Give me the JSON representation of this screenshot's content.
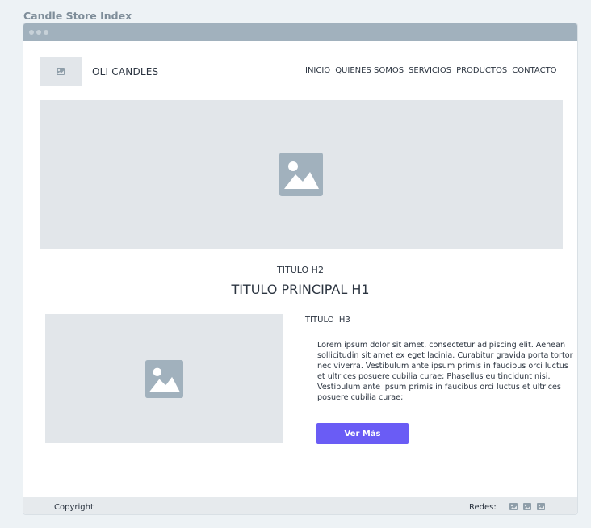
{
  "document": {
    "title": "Candle Store Index"
  },
  "header": {
    "brand": "OLI CANDLES",
    "nav": [
      "INICIO",
      "QUIENES SOMOS",
      "SERVICIOS",
      "PRODUCTOS",
      "CONTACTO"
    ]
  },
  "icons": {
    "logo": "image-placeholder-icon",
    "hero": "image-placeholder-icon",
    "feature": "image-placeholder-icon",
    "social": [
      "image-placeholder-icon",
      "image-placeholder-icon",
      "image-placeholder-icon"
    ]
  },
  "main": {
    "subtitle": "TITULO H2",
    "title": "TITULO PRINCIPAL H1",
    "section_title": "TITULO  H3",
    "body": "Lorem ipsum dolor sit amet, consectetur adipiscing elit. Aenean sollicitudin sit amet ex eget lacinia. Curabitur gravida porta tortor nec viverra. Vestibulum ante ipsum primis in faucibus orci luctus et ultrices posuere cubilia curae; Phasellus eu tincidunt nisi. Vestibulum ante ipsum primis in faucibus orci luctus et ultrices posuere cubilia curae;",
    "cta_label": "Ver Más"
  },
  "footer": {
    "copyright": "Copyright",
    "redes_label": "Redes:"
  },
  "colors": {
    "accent": "#6a5cf5",
    "placeholder_bg": "#e2e6ea",
    "placeholder_icon": "#a1b1bd",
    "chrome": "#a1b1bd"
  }
}
